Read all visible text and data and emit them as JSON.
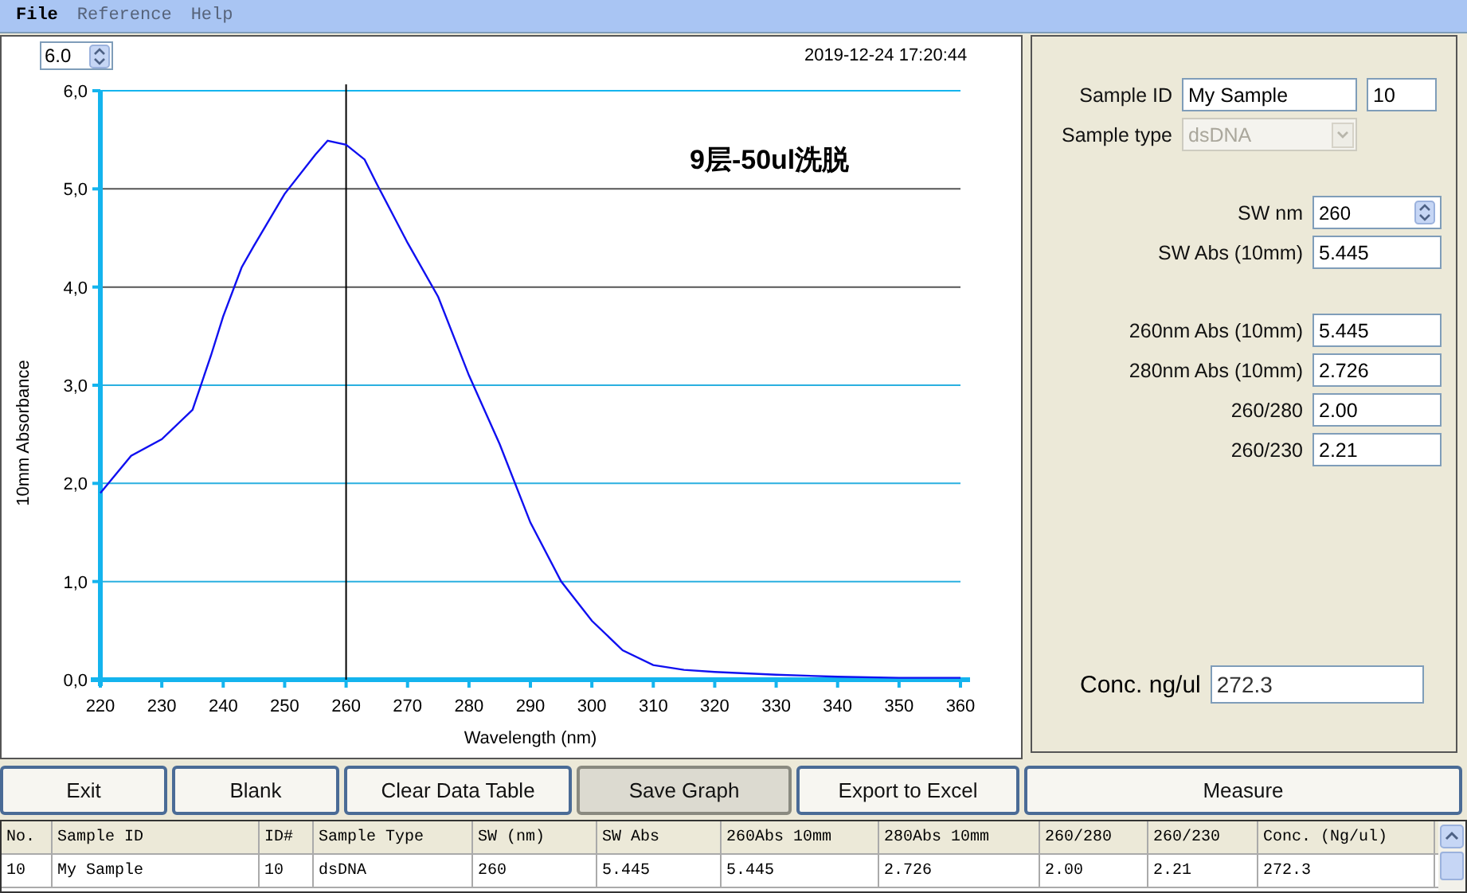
{
  "menu": [
    {
      "label": "File",
      "disabled": false
    },
    {
      "label": "Reference",
      "disabled": true
    },
    {
      "label": "Help",
      "disabled": true
    }
  ],
  "graph": {
    "ymax_spinner": "6.0",
    "timestamp": "2019-12-24 17:20:44",
    "chart_data": {
      "type": "line",
      "title": "9层-50ul洗脱",
      "xlabel": "Wavelength (nm)",
      "ylabel": "10mm Absorbance",
      "x": [
        220,
        225,
        230,
        235,
        238,
        240,
        243,
        245,
        250,
        255,
        257,
        260,
        263,
        265,
        270,
        275,
        280,
        285,
        290,
        295,
        300,
        305,
        310,
        315,
        320,
        330,
        340,
        350,
        360
      ],
      "series": [
        {
          "color": "#1010f0",
          "values": [
            1.9,
            2.28,
            2.45,
            2.75,
            3.3,
            3.7,
            4.2,
            4.42,
            4.95,
            5.35,
            5.49,
            5.45,
            5.3,
            5.05,
            4.45,
            3.9,
            3.1,
            2.4,
            1.6,
            1.0,
            0.6,
            0.3,
            0.15,
            0.1,
            0.08,
            0.05,
            0.03,
            0.02,
            0.02
          ]
        }
      ],
      "xlim": [
        220,
        360
      ],
      "ylim": [
        0,
        6
      ],
      "xticks": [
        220,
        230,
        240,
        250,
        260,
        270,
        280,
        290,
        300,
        310,
        320,
        330,
        340,
        350,
        360
      ],
      "yticks": [
        {
          "value": 0,
          "label": "0,0"
        },
        {
          "value": 1,
          "label": "1,0"
        },
        {
          "value": 2,
          "label": "2,0"
        },
        {
          "value": 3,
          "label": "3,0"
        },
        {
          "value": 4,
          "label": "4,0"
        },
        {
          "value": 5,
          "label": "5,0"
        },
        {
          "value": 6,
          "label": "6,0"
        }
      ],
      "grid": true,
      "ref_lines": [
        {
          "axis": "x",
          "value": 260
        }
      ]
    }
  },
  "sample_panel": {
    "sample_id_label": "Sample ID",
    "sample_id": "My Sample",
    "id_number": "10",
    "sample_type": {
      "label": "Sample type",
      "value": "dsDNA",
      "disabled": true
    },
    "field_groups": [
      [
        {
          "kind": "spinner",
          "label": "SW nm",
          "value": "260"
        },
        {
          "kind": "text",
          "label": "SW Abs (10mm)",
          "value": "5.445"
        }
      ],
      [
        {
          "kind": "text",
          "label": "260nm Abs (10mm)",
          "value": "5.445"
        },
        {
          "kind": "text",
          "label": "280nm Abs (10mm)",
          "value": "2.726"
        },
        {
          "kind": "text",
          "label": "260/280",
          "value": "2.00"
        },
        {
          "kind": "text",
          "label": "260/230",
          "value": "2.21"
        }
      ]
    ],
    "concentration": {
      "label": "Conc. ng/ul",
      "value": "272.3"
    }
  },
  "buttons": [
    {
      "label": "Exit",
      "pressed": false
    },
    {
      "label": "Blank",
      "pressed": false
    },
    {
      "label": "Clear Data Table",
      "pressed": false
    },
    {
      "label": "Save Graph",
      "pressed": true
    },
    {
      "label": "Export to Excel",
      "pressed": false
    },
    {
      "label": "Measure",
      "pressed": false
    }
  ],
  "table": {
    "columns": [
      "No.",
      "Sample ID",
      "ID#",
      "Sample Type",
      "SW (nm)",
      "SW Abs",
      "260Abs 10mm",
      "280Abs 10mm",
      "260/280",
      "260/230",
      "Conc. (Ng/ul)"
    ],
    "rows": [
      [
        "10",
        "My Sample",
        "10",
        "dsDNA",
        "260",
        "5.445",
        "5.445",
        "2.726",
        "2.00",
        "2.21",
        "272.3"
      ]
    ]
  }
}
